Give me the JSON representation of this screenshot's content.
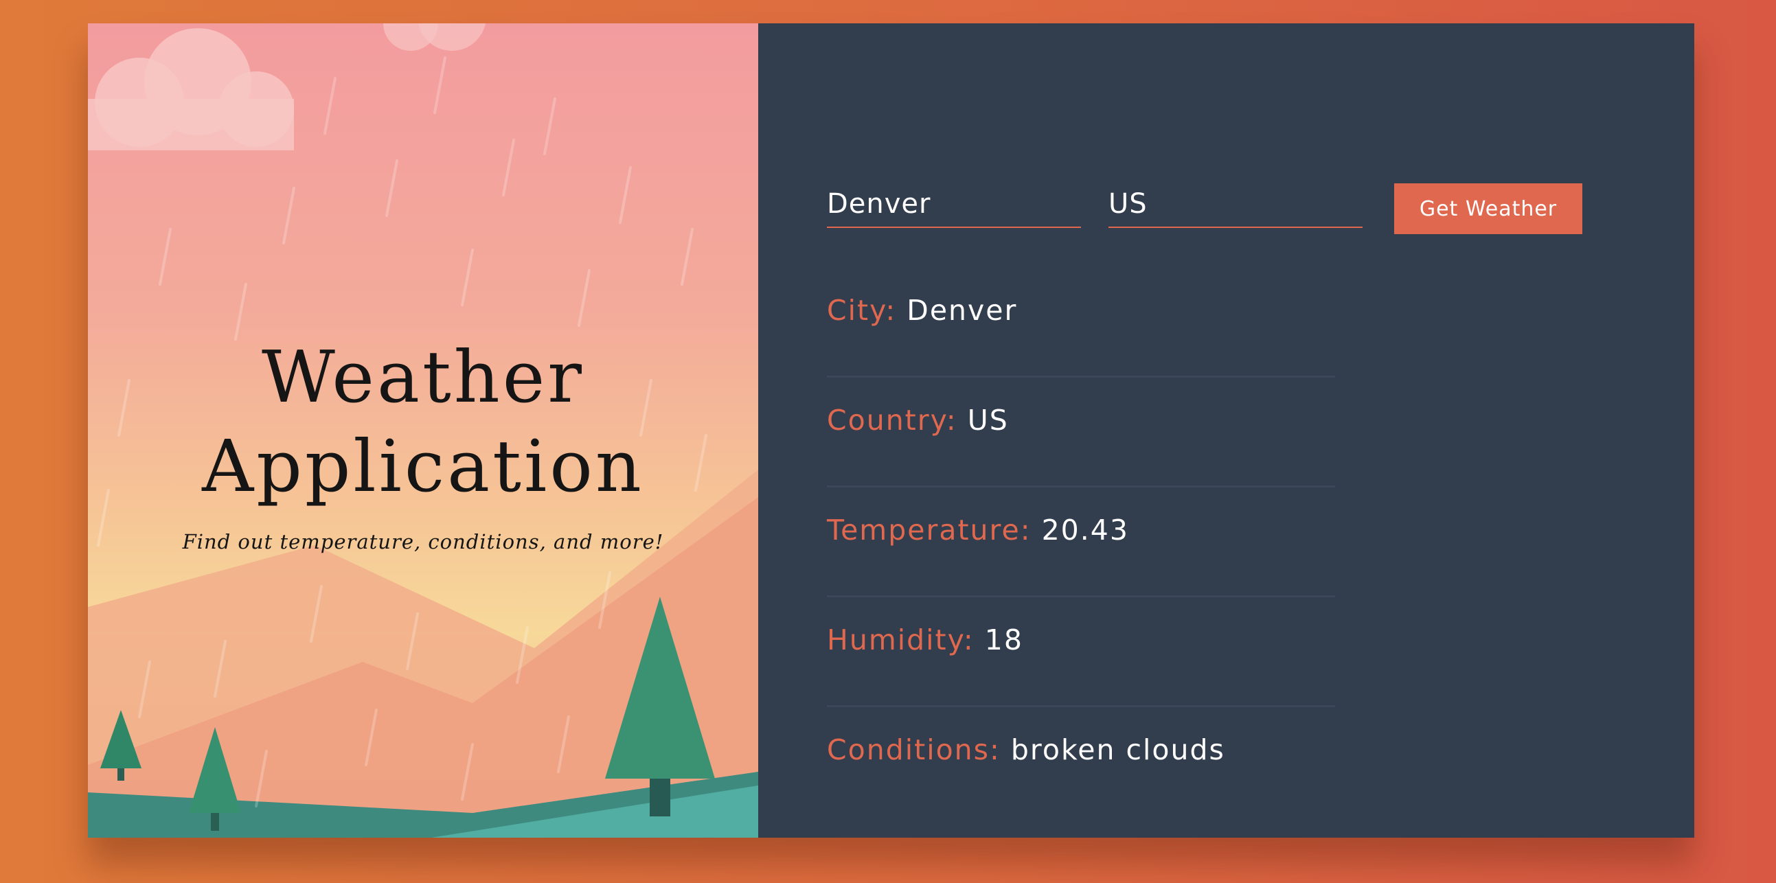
{
  "colors": {
    "accent": "#e0684f",
    "panel": "#323e4e",
    "title_text": "#151515",
    "value_text": "#ffffff"
  },
  "hero": {
    "title_line1": "Weather",
    "title_line2": "Application",
    "subtitle": "Find out temperature, conditions, and more!"
  },
  "form": {
    "city_value": "Denver",
    "country_value": "US",
    "submit_label": "Get Weather"
  },
  "results": {
    "city_label": "City:",
    "city_value": "Denver",
    "country_label": "Country:",
    "country_value": "US",
    "temperature_label": "Temperature:",
    "temperature_value": "20.43",
    "humidity_label": "Humidity:",
    "humidity_value": "18",
    "conditions_label": "Conditions:",
    "conditions_value": "broken clouds"
  }
}
